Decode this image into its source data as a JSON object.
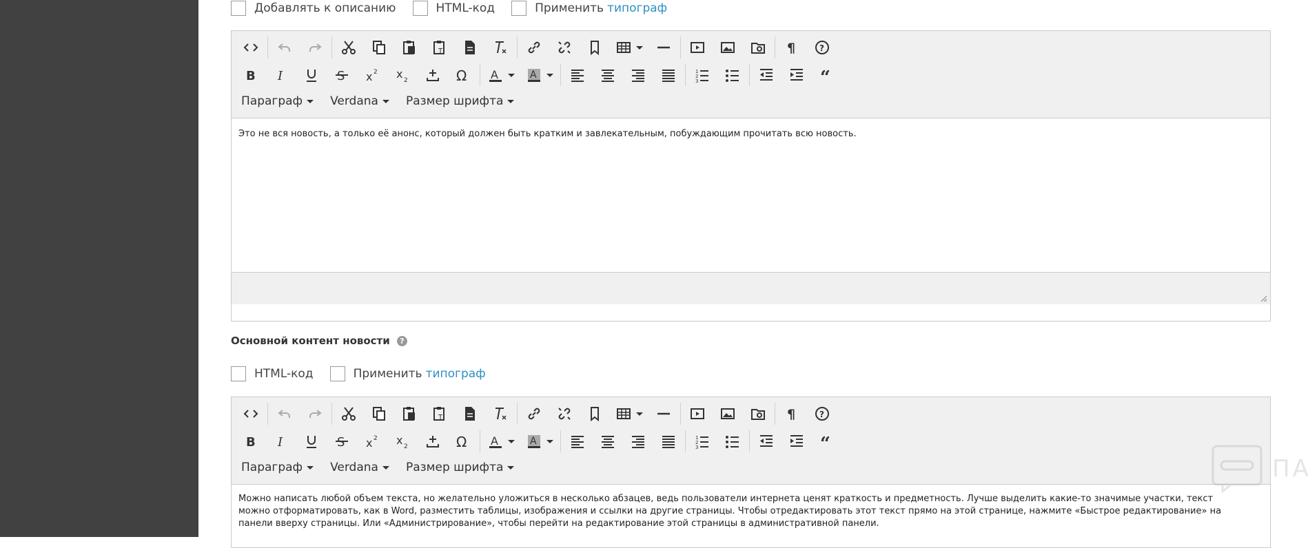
{
  "top_options": {
    "add_to_description": "Добавлять к описанию",
    "html_code": "HTML-код",
    "apply": "Применить",
    "typograph": "типограф"
  },
  "toolbar": {
    "paragraph": "Параграф",
    "font": "Verdana",
    "font_size": "Размер шрифта"
  },
  "editor1": {
    "text": "Это не вся новость, а только её анонс, который должен быть кратким и завлекательным, побуждающим прочитать всю новость."
  },
  "section2": {
    "title": "Основной контент новости",
    "help": "?",
    "html_code": "HTML-код",
    "apply": "Применить",
    "typograph": "типограф"
  },
  "editor2": {
    "text_lines": [
      "Можно написать любой объем текста, но желательно уложиться в несколько абзацев, ведь пользователи интернета ценят краткость и предметность. Лучше выделить какие-то значимые участки, текст",
      "можно отформатировать, как в Word, разместить таблицы, изображения и ссылки на другие страницы. Чтобы отредактировать этот текст прямо на этой странице, нажмите «Быстрое редактирование» на",
      "панели вверху страницы. Или «Администрирование», чтобы перейти на редактирование этой страницы в административной панели."
    ]
  },
  "watermark": {
    "text": "ПАРТНЕРКИН"
  },
  "icons": [
    "code-icon",
    "undo-icon",
    "redo-icon",
    "cut-icon",
    "copy-icon",
    "paste-icon",
    "paste-text-icon",
    "paste-word-icon",
    "clear-format-icon",
    "link-icon",
    "unlink-icon",
    "anchor-icon",
    "table-icon",
    "hr-icon",
    "media-icon",
    "image-icon",
    "file-manager-icon",
    "show-blocks-icon",
    "help-icon",
    "bold-icon",
    "italic-icon",
    "underline-icon",
    "strikethrough-icon",
    "superscript-icon",
    "subscript-icon",
    "insert-icon",
    "omega-icon",
    "text-color-icon",
    "bg-color-icon",
    "align-left-icon",
    "align-center-icon",
    "align-right-icon",
    "align-justify-icon",
    "numbered-list-icon",
    "bullet-list-icon",
    "outdent-icon",
    "indent-icon",
    "blockquote-icon"
  ],
  "colors": {
    "sidebar": "#414141",
    "link": "#2e8fc4",
    "toolbar_bg": "#f0f0f0"
  }
}
